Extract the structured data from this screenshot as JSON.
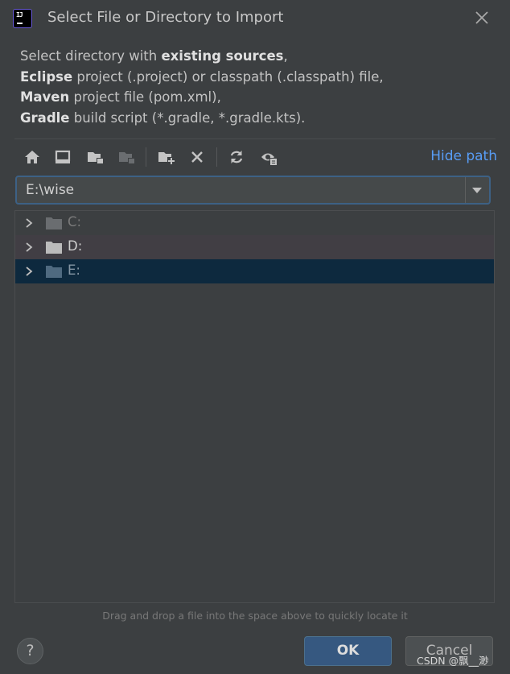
{
  "dialog": {
    "title": "Select File or Directory to Import",
    "description_lines": [
      {
        "prefix": "Select directory with ",
        "bold": "existing sources",
        "suffix": ","
      },
      {
        "prefix": "",
        "bold": "Eclipse",
        "suffix": " project (.project) or classpath (.classpath) file,"
      },
      {
        "prefix": "",
        "bold": "Maven",
        "suffix": " project file (pom.xml),"
      },
      {
        "prefix": "",
        "bold": "Gradle",
        "suffix": " build script (*.gradle, *.gradle.kts)."
      }
    ]
  },
  "toolbar": {
    "buttons": [
      {
        "name": "home-directory-button",
        "icon": "home-icon"
      },
      {
        "name": "desktop-directory-button",
        "icon": "desktop-icon"
      },
      {
        "name": "project-directory-button",
        "icon": "project-folder-icon"
      },
      {
        "name": "module-directory-button",
        "icon": "module-folder-icon"
      },
      {
        "name": "new-folder-button",
        "icon": "new-folder-icon"
      },
      {
        "name": "delete-button",
        "icon": "delete-icon"
      },
      {
        "name": "refresh-button",
        "icon": "refresh-icon"
      },
      {
        "name": "show-hidden-files-button",
        "icon": "show-hidden-icon"
      }
    ],
    "hide_path_label": "Hide path"
  },
  "path": {
    "value": "E:\\wise"
  },
  "tree": {
    "items": [
      {
        "label": "C:",
        "selected": false,
        "dimmed": true
      },
      {
        "label": "D:",
        "selected": false,
        "dimmed": false
      },
      {
        "label": "E:",
        "selected": true,
        "dimmed": true
      }
    ]
  },
  "hint": "Drag and drop a file into the space above to quickly locate it",
  "footer": {
    "help_label": "?",
    "ok_label": "OK",
    "cancel_label": "Cancel"
  },
  "watermark": "CSDN @飘__渺",
  "colors": {
    "background": "#3c3f41",
    "accent": "#589df6",
    "selection": "#0d293e",
    "ok_button": "#365880"
  }
}
